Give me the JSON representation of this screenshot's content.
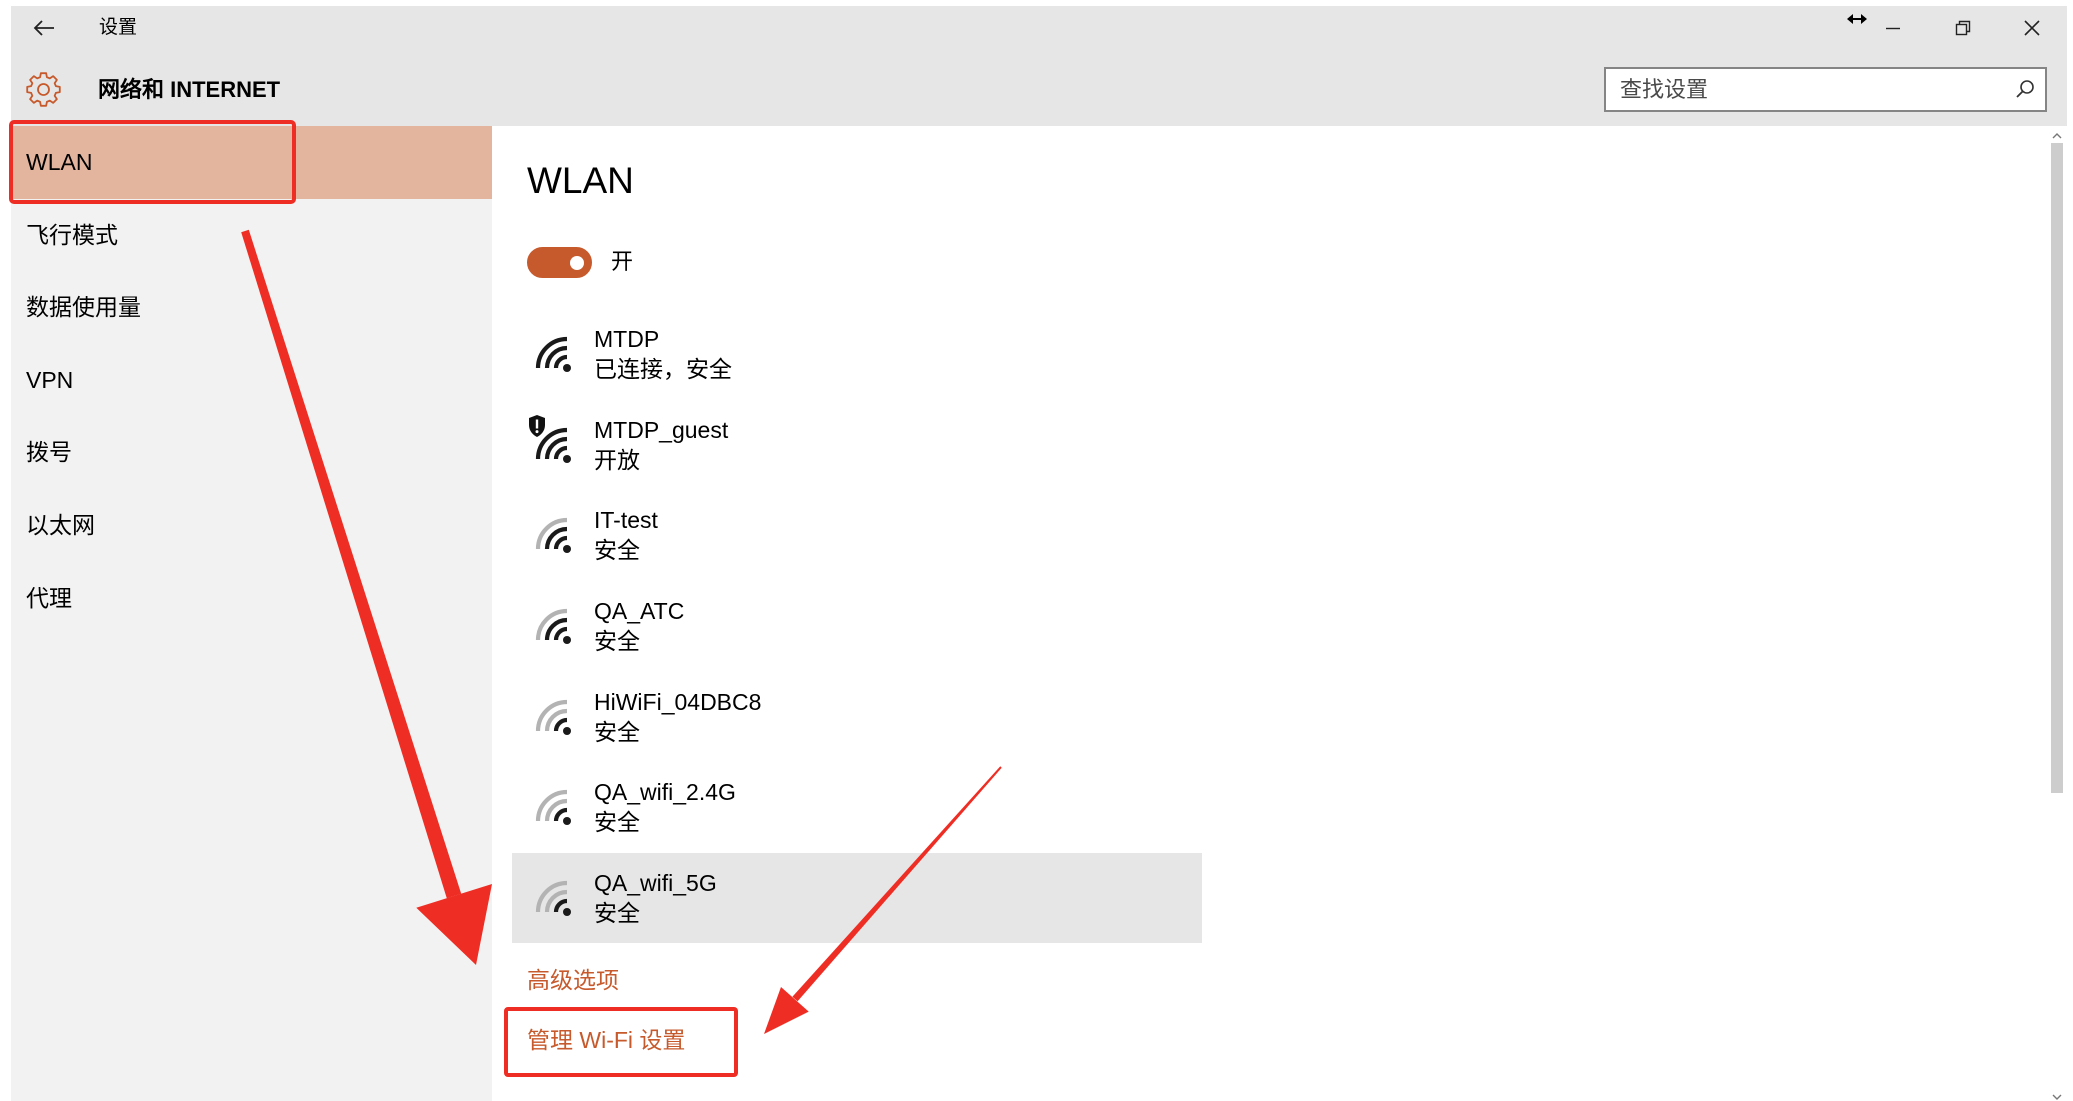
{
  "window": {
    "title": "设置",
    "icons": {
      "back": "back-arrow-icon",
      "cursor": "resize-cursor-icon",
      "minimize": "minimize-icon",
      "restore": "restore-icon",
      "close": "close-icon"
    }
  },
  "header": {
    "title": "网络和 INTERNET",
    "icon": "gear-icon",
    "search": {
      "placeholder": "查找设置",
      "value": "",
      "icon": "search-icon"
    }
  },
  "sidebar": {
    "items": [
      {
        "label": "WLAN",
        "selected": true
      },
      {
        "label": "飞行模式",
        "selected": false
      },
      {
        "label": "数据使用量",
        "selected": false
      },
      {
        "label": "VPN",
        "selected": false
      },
      {
        "label": "拨号",
        "selected": false
      },
      {
        "label": "以太网",
        "selected": false
      },
      {
        "label": "代理",
        "selected": false
      }
    ]
  },
  "main": {
    "title": "WLAN",
    "wifi_toggle": {
      "on": true,
      "label": "开"
    },
    "networks": [
      {
        "name": "MTDP",
        "status": "已连接，安全",
        "signal": 4,
        "icon": "wifi-signal-icon",
        "highlighted": false
      },
      {
        "name": "MTDP_guest",
        "status": "开放",
        "signal": 4,
        "icon": "wifi-signal-icon",
        "badge_icon": "shield-warning-icon",
        "highlighted": false
      },
      {
        "name": "IT-test",
        "status": "安全",
        "signal": 3,
        "icon": "wifi-signal-icon",
        "highlighted": false
      },
      {
        "name": "QA_ATC",
        "status": "安全",
        "signal": 3,
        "icon": "wifi-signal-icon",
        "highlighted": false
      },
      {
        "name": "HiWiFi_04DBC8",
        "status": "安全",
        "signal": 2,
        "icon": "wifi-signal-icon",
        "highlighted": false
      },
      {
        "name": "QA_wifi_2.4G",
        "status": "安全",
        "signal": 2,
        "icon": "wifi-signal-icon",
        "highlighted": false
      },
      {
        "name": "QA_wifi_5G",
        "status": "安全",
        "signal": 2,
        "icon": "wifi-signal-icon",
        "highlighted": true
      }
    ],
    "links": {
      "advanced_options": "高级选项",
      "manage_wifi_settings": "管理 Wi-Fi 设置"
    }
  },
  "colors": {
    "accent": "#c75a2c",
    "selected_item_bg": "#e3b59e",
    "highlight_row_bg": "#e6e6e6",
    "chrome_bg": "#e6e6e6",
    "sidebar_bg": "#f2f2f2",
    "annotation_red": "#ee2e24",
    "signal_strong": "#1a1a1a",
    "signal_weak": "#b3b3b3"
  }
}
